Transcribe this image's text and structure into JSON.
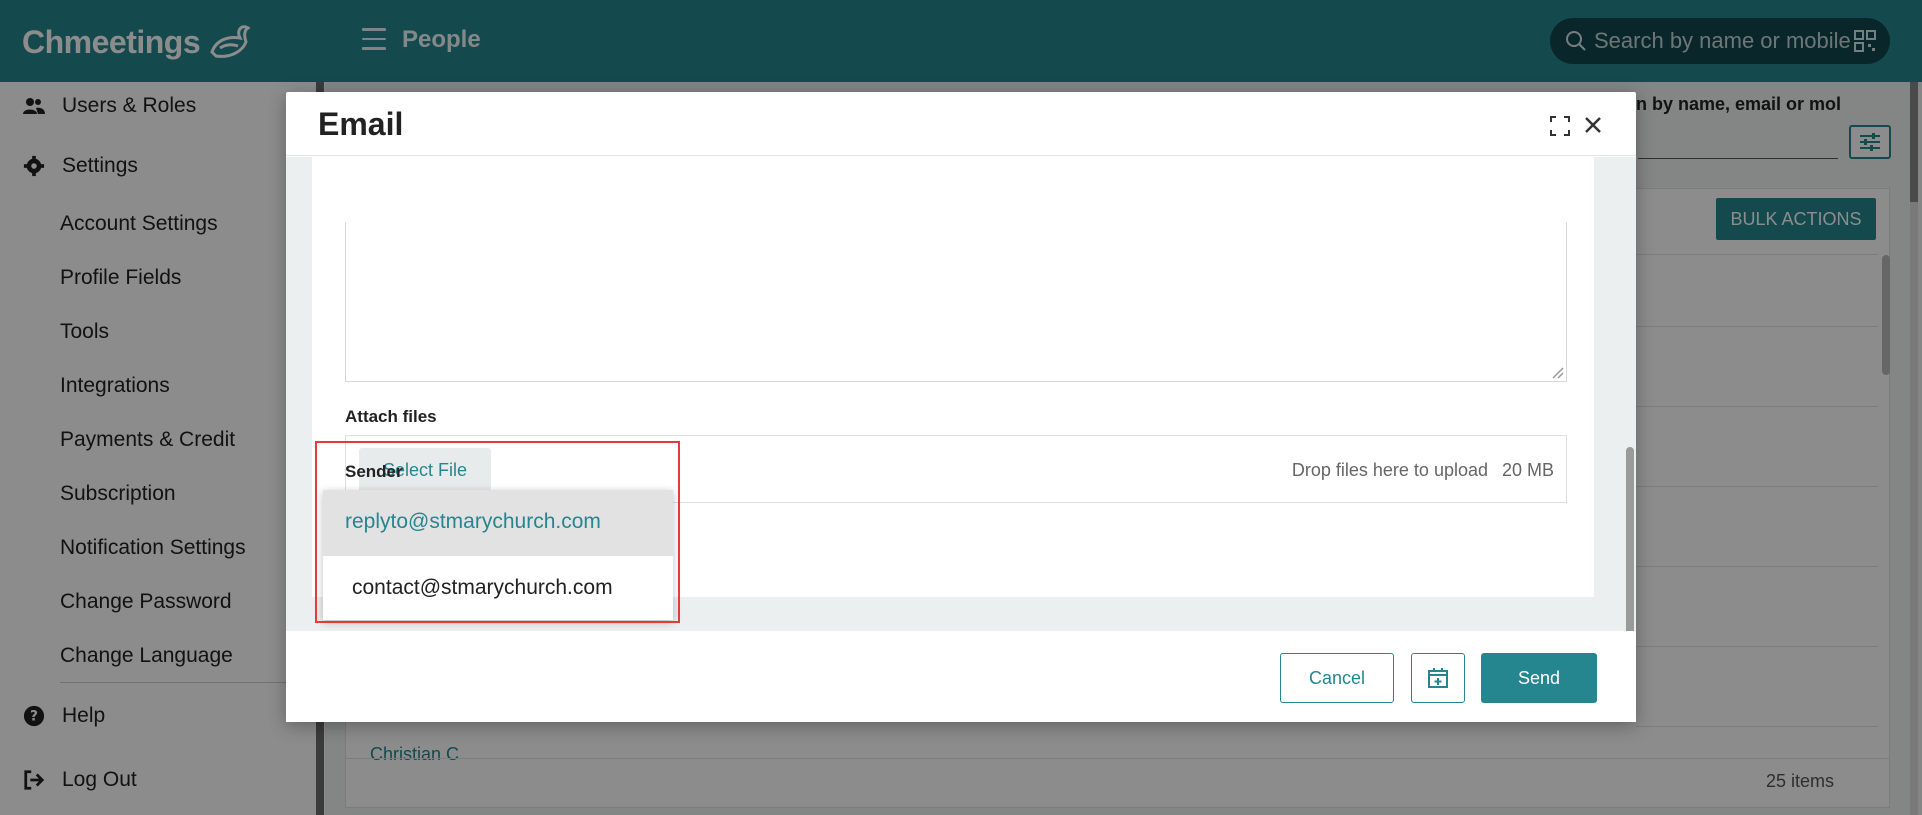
{
  "app": {
    "logo_text": "Chmeetings"
  },
  "header": {
    "page_title": "People",
    "search_placeholder": "Search by name or mobile"
  },
  "sidebar": {
    "users_roles": "Users & Roles",
    "settings": "Settings",
    "settings_items": [
      "Account Settings",
      "Profile Fields",
      "Tools",
      "Integrations",
      "Payments & Credit",
      "Subscription",
      "Notification Settings",
      "Change Password",
      "Change Language"
    ],
    "help": "Help",
    "logout": "Log Out"
  },
  "main": {
    "search_hint": "n by name, email or mol",
    "bulk_actions": "BULK ACTIONS",
    "row_peek": "Christian C",
    "items_count": "25 items"
  },
  "modal": {
    "title": "Email",
    "attach_label": "Attach files",
    "select_file": "Select File",
    "drop_text": "Drop files here to upload",
    "max_size": "20 MB",
    "sender_label": "Sender",
    "sender_options": [
      "replyto@stmarychurch.com",
      "contact@stmarychurch.com"
    ],
    "cancel": "Cancel",
    "send": "Send"
  },
  "colors": {
    "brand": "#26868f",
    "highlight_border": "#e33a3a"
  }
}
